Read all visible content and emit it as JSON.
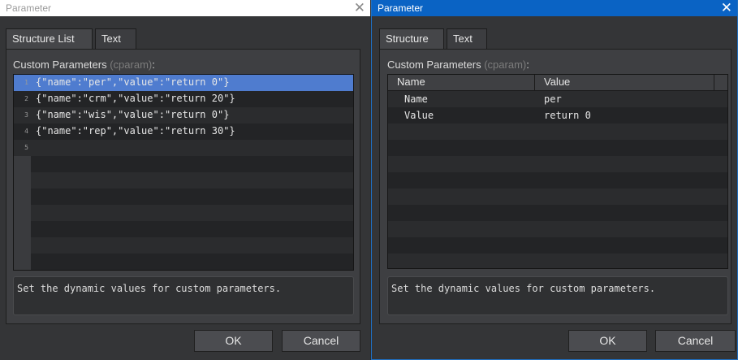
{
  "left_dialog": {
    "title": "Parameter",
    "tabs": [
      "Structure List",
      "Text"
    ],
    "field_label": "Custom Parameters",
    "field_hint": "(cparam)",
    "field_colon": ":",
    "lines": [
      {
        "num": "1",
        "text": "{\"name\":\"per\",\"value\":\"return 0\"}"
      },
      {
        "num": "2",
        "text": "{\"name\":\"crm\",\"value\":\"return 20\"}"
      },
      {
        "num": "3",
        "text": "{\"name\":\"wis\",\"value\":\"return 0\"}"
      },
      {
        "num": "4",
        "text": "{\"name\":\"rep\",\"value\":\"return 30\"}"
      },
      {
        "num": "5",
        "text": ""
      }
    ],
    "description": "Set the dynamic values for custom parameters.",
    "ok_label": "OK",
    "cancel_label": "Cancel"
  },
  "right_dialog": {
    "title": "Parameter",
    "tabs": [
      "Structure",
      "Text"
    ],
    "field_label": "Custom Parameters",
    "field_hint": "(cparam)",
    "field_colon": ":",
    "columns": [
      "Name",
      "Value"
    ],
    "rows": [
      {
        "name": "Name",
        "value": "per"
      },
      {
        "name": "Value",
        "value": "return 0"
      }
    ],
    "description": "Set the dynamic values for custom parameters.",
    "ok_label": "OK",
    "cancel_label": "Cancel"
  },
  "icons": {
    "close": "close-icon"
  },
  "colors": {
    "selection": "#4f7ccf",
    "active_titlebar": "#0a63c4"
  }
}
